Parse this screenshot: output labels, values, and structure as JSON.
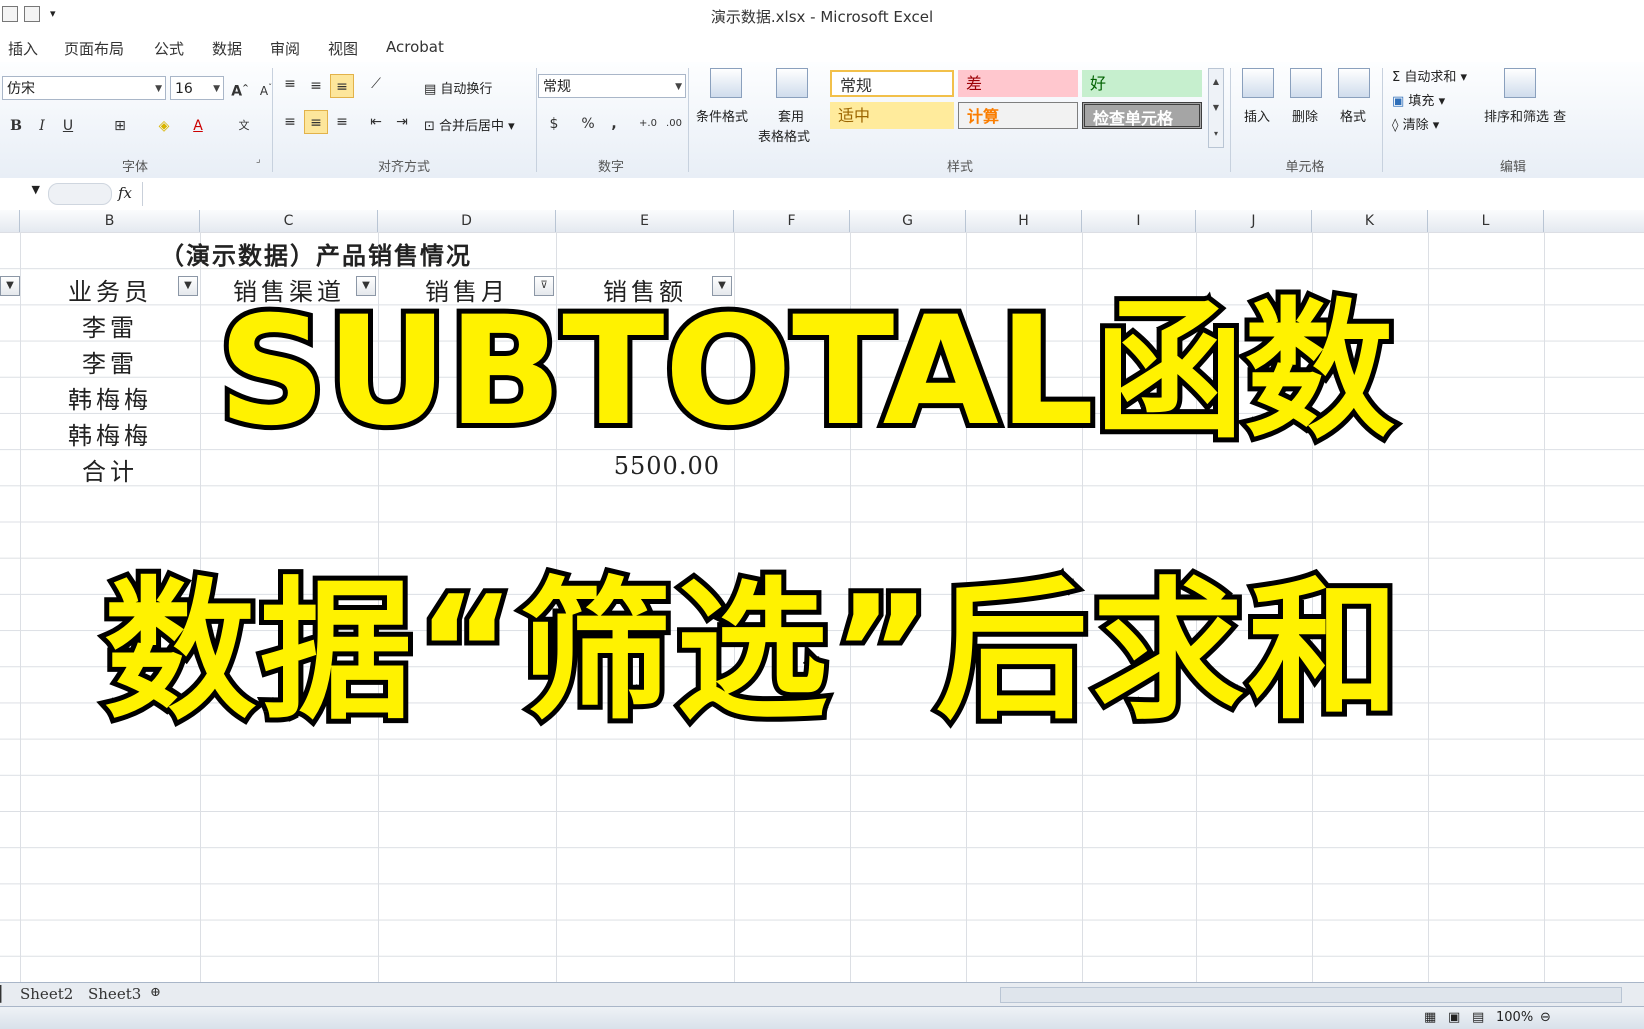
{
  "window": {
    "title": "演示数据.xlsx - Microsoft Excel"
  },
  "menu": [
    "插入",
    "页面布局",
    "公式",
    "数据",
    "审阅",
    "视图",
    "Acrobat"
  ],
  "ribbon": {
    "font": {
      "name": "仿宋",
      "size": "16",
      "group_label": "字体"
    },
    "align": {
      "wrap_label": "自动换行",
      "merge_label": "合并后居中",
      "group_label": "对齐方式"
    },
    "number": {
      "format": "常规",
      "group_label": "数字",
      "percent": "%",
      "comma": ","
    },
    "styles": {
      "cond_format": "条件格式",
      "table_format_1": "套用",
      "table_format_2": "表格格式",
      "group_label": "样式",
      "cells": [
        "常规",
        "差",
        "好",
        "适中",
        "计算",
        "检查单元格"
      ]
    },
    "cells_group": {
      "insert": "插入",
      "delete": "删除",
      "format": "格式",
      "group_label": "单元格"
    },
    "edit": {
      "autosum": "自动求和",
      "fill": "填充",
      "clear": "清除",
      "sort": "排序和筛选",
      "find": "查",
      "group_label": "编辑"
    }
  },
  "formula_bar": {
    "fx": "fx"
  },
  "columns": [
    "B",
    "C",
    "D",
    "E",
    "F",
    "G",
    "H",
    "I",
    "J",
    "K",
    "L"
  ],
  "sheet": {
    "title": "（演示数据）产品销售情况",
    "headers": [
      "业务员",
      "销售渠道",
      "销售月",
      "销售额"
    ],
    "rows": [
      [
        "李雷"
      ],
      [
        "李雷"
      ],
      [
        "韩梅梅"
      ],
      [
        "韩梅梅"
      ]
    ],
    "total_label": "合计",
    "total_value": "5500.00"
  },
  "overlay": {
    "line1": "SUBTOTAL函数",
    "line2": "数据“筛选”后求和"
  },
  "tabs": [
    "Sheet2",
    "Sheet3"
  ],
  "status": {
    "zoom": "100%"
  }
}
